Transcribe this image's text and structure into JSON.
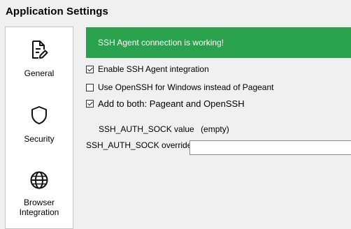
{
  "window": {
    "title": "Application Settings"
  },
  "sidebar": {
    "items": [
      {
        "label": "General",
        "icon": "document-edit-icon"
      },
      {
        "label": "Security",
        "icon": "shield-icon"
      },
      {
        "label": "Browser\nIntegration",
        "icon": "globe-icon"
      }
    ]
  },
  "banner": {
    "text": "SSH Agent connection is working!",
    "color": "#2aa24d"
  },
  "options": {
    "enable_agent": {
      "label": "Enable SSH Agent integration",
      "checked": true
    },
    "use_openssh": {
      "label": "Use OpenSSH for Windows instead of Pageant",
      "checked": false
    },
    "add_both": {
      "label": "Add to both: Pageant and OpenSSH",
      "checked": true
    }
  },
  "ssh_auth_sock": {
    "label": "SSH_AUTH_SOCK value",
    "value": "(empty)"
  },
  "override": {
    "label": "SSH_AUTH_SOCK override",
    "value": "",
    "placeholder": ""
  }
}
